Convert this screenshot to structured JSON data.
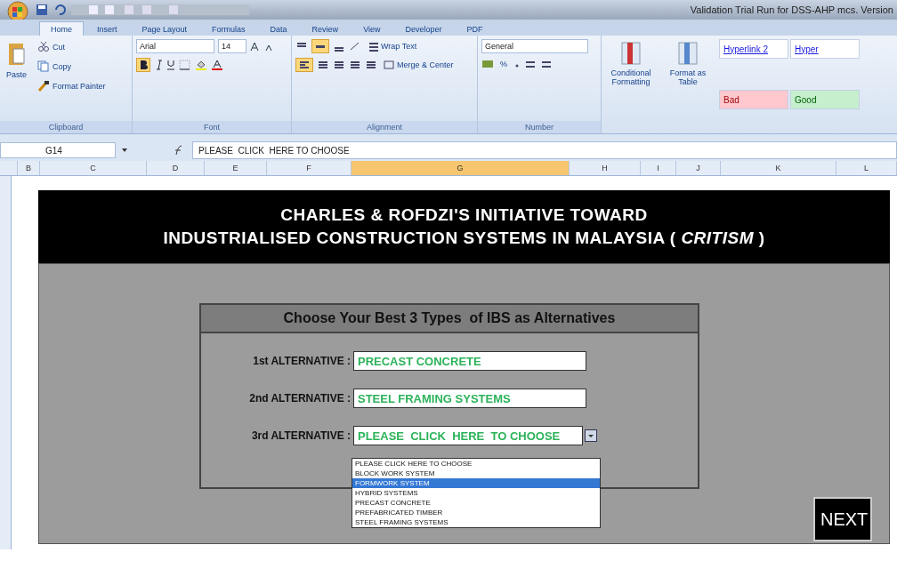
{
  "window": {
    "title": "Validation Trial Run for DSS-AHP mcs. Version"
  },
  "tabs": [
    {
      "label": "Home",
      "selected": true
    },
    {
      "label": "Insert",
      "selected": false
    },
    {
      "label": "Page Layout",
      "selected": false
    },
    {
      "label": "Formulas",
      "selected": false
    },
    {
      "label": "Data",
      "selected": false
    },
    {
      "label": "Review",
      "selected": false
    },
    {
      "label": "View",
      "selected": false
    },
    {
      "label": "Developer",
      "selected": false
    },
    {
      "label": "PDF",
      "selected": false
    }
  ],
  "ribbon": {
    "clipboard": {
      "label": "Clipboard",
      "paste": "Paste",
      "cut": "Cut",
      "copy": "Copy",
      "format_painter": "Format Painter"
    },
    "font": {
      "label": "Font",
      "name": "Arial",
      "size": "14",
      "bold": true
    },
    "alignment": {
      "label": "Alignment",
      "wrap_text": "Wrap Text",
      "merge_center": "Merge & Center",
      "align_middle": true,
      "align_left": true
    },
    "number": {
      "label": "Number",
      "format": "General",
      "percent": "%"
    },
    "styles": {
      "conditional_formatting": "Conditional Formatting",
      "format_as_table": "Format as Table",
      "cells": [
        {
          "label": "Hyperlink 2",
          "kind": "link"
        },
        {
          "label": "Hyper",
          "kind": "link"
        },
        {
          "label": "Bad",
          "kind": "bad"
        },
        {
          "label": "Good",
          "kind": "good"
        }
      ]
    }
  },
  "formula_bar": {
    "name_box": "G14",
    "formula": "PLEASE  CLICK  HERE TO CHOOSE"
  },
  "columns": [
    {
      "label": "B",
      "selected": false
    },
    {
      "label": "C",
      "selected": false
    },
    {
      "label": "D",
      "selected": false
    },
    {
      "label": "E",
      "selected": false
    },
    {
      "label": "F",
      "selected": false
    },
    {
      "label": "G",
      "selected": true
    },
    {
      "label": "H",
      "selected": false
    },
    {
      "label": "I",
      "selected": false
    },
    {
      "label": "J",
      "selected": false
    },
    {
      "label": "K",
      "selected": false
    },
    {
      "label": "L",
      "selected": false
    }
  ],
  "sheet": {
    "banner": [
      "CHARLES & ROFDZI'S INITIATIVE TOWARD",
      "INDUSTRIALISED CONSTRUCTION SYSTEMS IN MALAYSIA ( *CRITISM* )"
    ],
    "panel_title": "Choose Your Best 3 Types  of IBS as Alternatives",
    "alternatives": [
      {
        "label": "1st ALTERNATIVE :",
        "value": "PRECAST CONCRETE",
        "kind": "text"
      },
      {
        "label": "2nd ALTERNATIVE :",
        "value": "STEEL FRAMING SYSTEMS",
        "kind": "text"
      },
      {
        "label": "3rd ALTERNATIVE :",
        "value": "PLEASE  CLICK  HERE  TO CHOOSE",
        "kind": "dropdown",
        "expanded": true
      }
    ],
    "options": [
      {
        "label": "PLEASE CLICK HERE TO CHOOSE",
        "selected": false
      },
      {
        "label": "BLOCK WORK SYSTEM",
        "selected": false
      },
      {
        "label": "FORMWORK SYSTEM",
        "selected": true
      },
      {
        "label": "HYBRID SYSTEMS",
        "selected": false
      },
      {
        "label": "PRECAST CONCRETE",
        "selected": false
      },
      {
        "label": "PREFABRICATED TIMBER",
        "selected": false
      },
      {
        "label": "STEEL FRAMING SYSTEMS",
        "selected": false
      }
    ],
    "next": "NEXT"
  }
}
